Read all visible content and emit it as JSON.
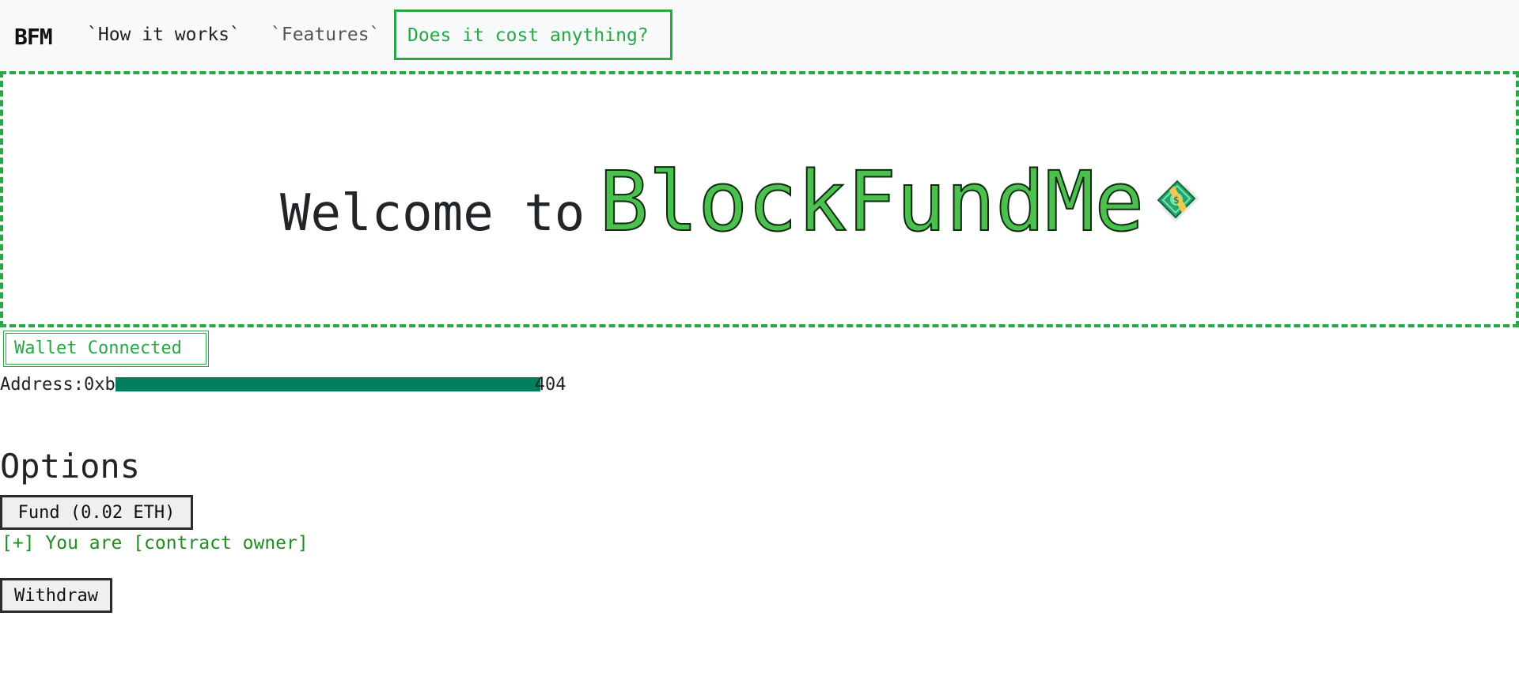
{
  "nav": {
    "brand": "BFM",
    "links": [
      "`How it works`",
      "`Features`"
    ],
    "cost_link": "Does it cost anything?"
  },
  "hero": {
    "welcome": "Welcome to",
    "brand": "BlockFundMe",
    "emoji_icon": "money-with-wings-icon"
  },
  "wallet": {
    "status": "Wallet Connected",
    "address_label": "Address:",
    "address_prefix": "0xb",
    "address_suffix": "404"
  },
  "options": {
    "title": "Options",
    "fund_label": "Fund (0.02 ETH)",
    "owner_note": "[+] You are [contract owner]",
    "withdraw_label": "Withdraw"
  },
  "colors": {
    "accent": "#28a745",
    "brand_fill": "#4cc04e",
    "redaction": "#007f5f"
  }
}
